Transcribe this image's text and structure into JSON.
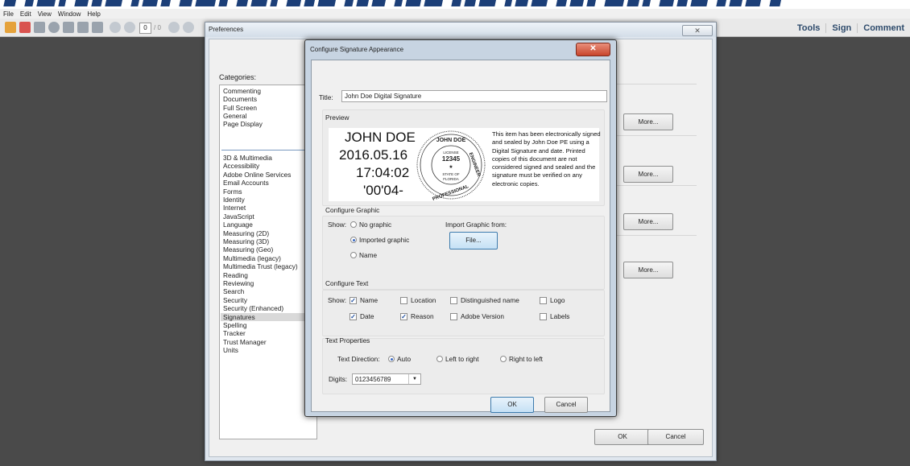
{
  "menubar": [
    "File",
    "Edit",
    "View",
    "Window",
    "Help"
  ],
  "toolbar": {
    "page_current": "0",
    "page_separator": "/ 0",
    "right_tabs": [
      "Tools",
      "Sign",
      "Comment"
    ]
  },
  "preferences": {
    "title": "Preferences",
    "close_symbol": "✕",
    "categories_label": "Categories:",
    "categories_top": [
      "Commenting",
      "Documents",
      "Full Screen",
      "General",
      "Page Display"
    ],
    "categories_bottom": [
      "3D & Multimedia",
      "Accessibility",
      "Adobe Online Services",
      "Email Accounts",
      "Forms",
      "Identity",
      "Internet",
      "JavaScript",
      "Language",
      "Measuring (2D)",
      "Measuring (3D)",
      "Measuring (Geo)",
      "Multimedia (legacy)",
      "Multimedia Trust (legacy)",
      "Reading",
      "Reviewing",
      "Search",
      "Security",
      "Security (Enhanced)",
      "Signatures",
      "Spelling",
      "Tracker",
      "Trust Manager",
      "Units"
    ],
    "selected_category": "Signatures",
    "more_label": "More...",
    "ok_label": "OK",
    "cancel_label": "Cancel"
  },
  "dialog": {
    "title": "Configure Signature Appearance",
    "close_symbol": "✕",
    "title_label": "Title:",
    "title_value": "John Doe Digital Signature",
    "preview_label": "Preview",
    "preview": {
      "name": "JOHN DOE",
      "date": "2016.05.16",
      "time": "17:04:02",
      "offset": "'00'04-",
      "seal_name": "JOHN DOE",
      "seal_license": "LICENSE",
      "seal_number": "12345",
      "seal_star": "★",
      "seal_state": "STATE OF",
      "seal_florida": "FLORIDA",
      "seal_left": "PROFESSIONAL",
      "seal_right": "ENGINEER",
      "statement": "This item has been electronically signed and sealed by John Doe PE using a Digital Signature and date. Printed copies of this document are not considered signed and sealed and the signature must be verified on any electronic copies."
    },
    "configure_graphic_label": "Configure Graphic",
    "show_label": "Show:",
    "graphic_options": [
      "No graphic",
      "Imported graphic",
      "Name"
    ],
    "graphic_selected": "Imported graphic",
    "import_from_label": "Import Graphic from:",
    "file_button": "File...",
    "configure_text_label": "Configure Text",
    "text_options": [
      {
        "label": "Name",
        "checked": true
      },
      {
        "label": "Location",
        "checked": false
      },
      {
        "label": "Distinguished name",
        "checked": false
      },
      {
        "label": "Logo",
        "checked": false
      },
      {
        "label": "Date",
        "checked": true
      },
      {
        "label": "Reason",
        "checked": true
      },
      {
        "label": "Adobe Version",
        "checked": false
      },
      {
        "label": "Labels",
        "checked": false
      }
    ],
    "text_properties_label": "Text Properties",
    "text_direction_label": "Text Direction:",
    "direction_options": [
      "Auto",
      "Left to right",
      "Right to left"
    ],
    "direction_selected": "Auto",
    "digits_label": "Digits:",
    "digits_value": "0123456789",
    "digits_arrow": "▼",
    "ok_label": "OK",
    "cancel_label": "Cancel"
  },
  "colors": {
    "background": "#4a4a4a",
    "accent": "#3b69c2",
    "close_red": "#c8452c",
    "toolbar_text": "#2d4a6b"
  }
}
